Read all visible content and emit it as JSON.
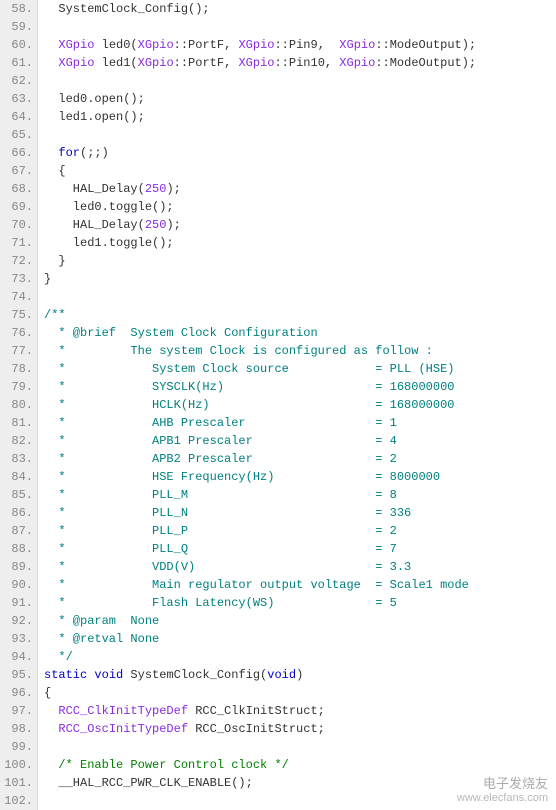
{
  "lines": [
    {
      "n": "58.",
      "tokens": [
        {
          "t": "  SystemClock_Config();",
          "c": ""
        }
      ]
    },
    {
      "n": "59.",
      "tokens": []
    },
    {
      "n": "60.",
      "tokens": [
        {
          "t": "  ",
          "c": ""
        },
        {
          "t": "XGpio",
          "c": "type"
        },
        {
          "t": " led0(",
          "c": ""
        },
        {
          "t": "XGpio",
          "c": "type"
        },
        {
          "t": "::PortF, ",
          "c": ""
        },
        {
          "t": "XGpio",
          "c": "type"
        },
        {
          "t": "::Pin9,  ",
          "c": ""
        },
        {
          "t": "XGpio",
          "c": "type"
        },
        {
          "t": "::ModeOutput);",
          "c": ""
        }
      ]
    },
    {
      "n": "61.",
      "tokens": [
        {
          "t": "  ",
          "c": ""
        },
        {
          "t": "XGpio",
          "c": "type"
        },
        {
          "t": " led1(",
          "c": ""
        },
        {
          "t": "XGpio",
          "c": "type"
        },
        {
          "t": "::PortF, ",
          "c": ""
        },
        {
          "t": "XGpio",
          "c": "type"
        },
        {
          "t": "::Pin10, ",
          "c": ""
        },
        {
          "t": "XGpio",
          "c": "type"
        },
        {
          "t": "::ModeOutput);",
          "c": ""
        }
      ]
    },
    {
      "n": "62.",
      "tokens": []
    },
    {
      "n": "63.",
      "tokens": [
        {
          "t": "  led0.open();",
          "c": ""
        }
      ]
    },
    {
      "n": "64.",
      "tokens": [
        {
          "t": "  led1.open();",
          "c": ""
        }
      ]
    },
    {
      "n": "65.",
      "tokens": []
    },
    {
      "n": "66.",
      "tokens": [
        {
          "t": "  ",
          "c": ""
        },
        {
          "t": "for",
          "c": "kw"
        },
        {
          "t": "(;;)",
          "c": ""
        }
      ]
    },
    {
      "n": "67.",
      "tokens": [
        {
          "t": "  {",
          "c": ""
        }
      ]
    },
    {
      "n": "68.",
      "tokens": [
        {
          "t": "    HAL_Delay(",
          "c": ""
        },
        {
          "t": "250",
          "c": "num"
        },
        {
          "t": ");",
          "c": ""
        }
      ]
    },
    {
      "n": "69.",
      "tokens": [
        {
          "t": "    led0.toggle();",
          "c": ""
        }
      ]
    },
    {
      "n": "70.",
      "tokens": [
        {
          "t": "    HAL_Delay(",
          "c": ""
        },
        {
          "t": "250",
          "c": "num"
        },
        {
          "t": ");",
          "c": ""
        }
      ]
    },
    {
      "n": "71.",
      "tokens": [
        {
          "t": "    led1.toggle();",
          "c": ""
        }
      ]
    },
    {
      "n": "72.",
      "tokens": [
        {
          "t": "  }",
          "c": ""
        }
      ]
    },
    {
      "n": "73.",
      "tokens": [
        {
          "t": "}",
          "c": ""
        }
      ]
    },
    {
      "n": "74.",
      "tokens": []
    },
    {
      "n": "75.",
      "tokens": [
        {
          "t": "/**",
          "c": "doccomment"
        }
      ]
    },
    {
      "n": "76.",
      "tokens": [
        {
          "t": "  * @brief  System Clock Configuration",
          "c": "doccomment"
        }
      ]
    },
    {
      "n": "77.",
      "tokens": [
        {
          "t": "  *         The system Clock is configured as follow :",
          "c": "doccomment"
        }
      ]
    },
    {
      "n": "78.",
      "tokens": [
        {
          "t": "  *            System Clock source            = PLL (HSE)",
          "c": "doccomment"
        }
      ]
    },
    {
      "n": "79.",
      "tokens": [
        {
          "t": "  *            SYSCLK(Hz)                     = 168000000",
          "c": "doccomment"
        }
      ]
    },
    {
      "n": "80.",
      "tokens": [
        {
          "t": "  *            HCLK(Hz)                       = 168000000",
          "c": "doccomment"
        }
      ]
    },
    {
      "n": "81.",
      "tokens": [
        {
          "t": "  *            AHB Prescaler                  = 1",
          "c": "doccomment"
        }
      ]
    },
    {
      "n": "82.",
      "tokens": [
        {
          "t": "  *            APB1 Prescaler                 = 4",
          "c": "doccomment"
        }
      ]
    },
    {
      "n": "83.",
      "tokens": [
        {
          "t": "  *            APB2 Prescaler                 = 2",
          "c": "doccomment"
        }
      ]
    },
    {
      "n": "84.",
      "tokens": [
        {
          "t": "  *            HSE Frequency(Hz)              = 8000000",
          "c": "doccomment"
        }
      ]
    },
    {
      "n": "85.",
      "tokens": [
        {
          "t": "  *            PLL_M                          = 8",
          "c": "doccomment"
        }
      ]
    },
    {
      "n": "86.",
      "tokens": [
        {
          "t": "  *            PLL_N                          = 336",
          "c": "doccomment"
        }
      ]
    },
    {
      "n": "87.",
      "tokens": [
        {
          "t": "  *            PLL_P                          = 2",
          "c": "doccomment"
        }
      ]
    },
    {
      "n": "88.",
      "tokens": [
        {
          "t": "  *            PLL_Q                          = 7",
          "c": "doccomment"
        }
      ]
    },
    {
      "n": "89.",
      "tokens": [
        {
          "t": "  *            VDD(V)                         = 3.3",
          "c": "doccomment"
        }
      ]
    },
    {
      "n": "90.",
      "tokens": [
        {
          "t": "  *            Main regulator output voltage  = Scale1 mode",
          "c": "doccomment"
        }
      ]
    },
    {
      "n": "91.",
      "tokens": [
        {
          "t": "  *            Flash Latency(WS)              = 5",
          "c": "doccomment"
        }
      ]
    },
    {
      "n": "92.",
      "tokens": [
        {
          "t": "  * @param  None",
          "c": "doccomment"
        }
      ]
    },
    {
      "n": "93.",
      "tokens": [
        {
          "t": "  * @retval None",
          "c": "doccomment"
        }
      ]
    },
    {
      "n": "94.",
      "tokens": [
        {
          "t": "  */",
          "c": "doccomment"
        }
      ]
    },
    {
      "n": "95.",
      "tokens": [
        {
          "t": "static",
          "c": "kw"
        },
        {
          "t": " ",
          "c": ""
        },
        {
          "t": "void",
          "c": "kw"
        },
        {
          "t": " SystemClock_Config(",
          "c": ""
        },
        {
          "t": "void",
          "c": "kw"
        },
        {
          "t": ")",
          "c": ""
        }
      ]
    },
    {
      "n": "96.",
      "tokens": [
        {
          "t": "{",
          "c": ""
        }
      ]
    },
    {
      "n": "97.",
      "tokens": [
        {
          "t": "  ",
          "c": ""
        },
        {
          "t": "RCC_ClkInitTypeDef",
          "c": "type"
        },
        {
          "t": " RCC_ClkInitStruct;",
          "c": ""
        }
      ]
    },
    {
      "n": "98.",
      "tokens": [
        {
          "t": "  ",
          "c": ""
        },
        {
          "t": "RCC_OscInitTypeDef",
          "c": "type"
        },
        {
          "t": " RCC_OscInitStruct;",
          "c": ""
        }
      ]
    },
    {
      "n": "99.",
      "tokens": []
    },
    {
      "n": "100.",
      "tokens": [
        {
          "t": "  /* Enable Power Control clock */",
          "c": "comment"
        }
      ]
    },
    {
      "n": "101.",
      "tokens": [
        {
          "t": "  __HAL_RCC_PWR_CLK_ENABLE();",
          "c": ""
        }
      ]
    },
    {
      "n": "102.",
      "tokens": []
    }
  ],
  "watermark": {
    "title": "电子发烧友",
    "url": "www.elecfans.com"
  }
}
